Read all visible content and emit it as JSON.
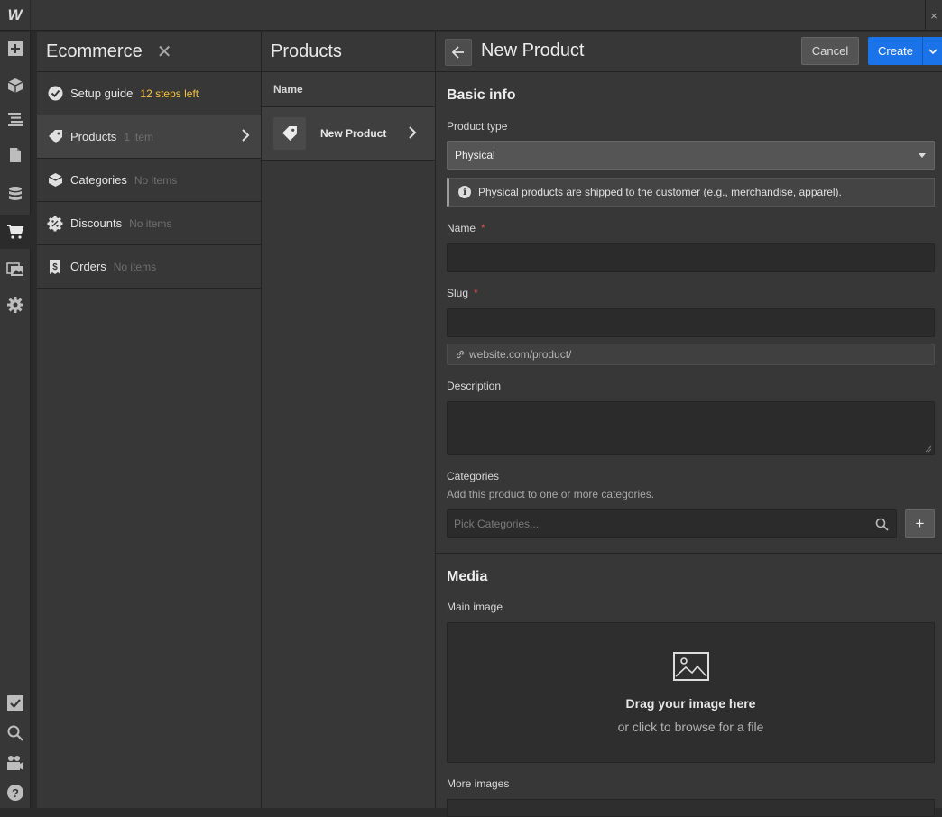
{
  "app": {
    "logo": "W"
  },
  "topbar": {
    "close": "×"
  },
  "leftbar": {
    "icons": [
      "add-icon",
      "cube-icon",
      "navigator-icon",
      "pages-icon",
      "cms-icon",
      "cart-icon",
      "assets-icon",
      "settings-icon",
      "checklist-icon",
      "search-icon",
      "video-icon",
      "help-icon"
    ]
  },
  "ecommerce": {
    "title": "Ecommerce",
    "close": "✕",
    "items": [
      {
        "label": "Setup guide",
        "meta": "12 steps left"
      },
      {
        "label": "Products",
        "meta": "1 item"
      },
      {
        "label": "Categories",
        "meta": "No items"
      },
      {
        "label": "Discounts",
        "meta": "No items"
      },
      {
        "label": "Orders",
        "meta": "No items"
      }
    ]
  },
  "products": {
    "title": "Products",
    "column": "Name",
    "items": [
      {
        "label": "New Product"
      }
    ]
  },
  "editor": {
    "title": "New Product",
    "cancel": "Cancel",
    "create": "Create",
    "basic_info": {
      "title": "Basic info",
      "product_type_label": "Product type",
      "product_type_value": "Physical",
      "info": "Physical products are shipped to the customer (e.g., merchandise, apparel).",
      "name_label": "Name",
      "slug_label": "Slug",
      "required": "*",
      "slug_hint": "website.com/product/",
      "description_label": "Description",
      "categories_label": "Categories",
      "categories_sub": "Add this product to one or more categories.",
      "categories_placeholder": "Pick Categories...",
      "add": "+"
    },
    "media": {
      "title": "Media",
      "main_image_label": "Main image",
      "drop_title": "Drag your image here",
      "drop_sub": "or click to browse for a file",
      "more_images_label": "More images"
    }
  },
  "colors": {
    "accent": "#1a73e8",
    "warning": "#f3c242",
    "required": "#e05050"
  }
}
